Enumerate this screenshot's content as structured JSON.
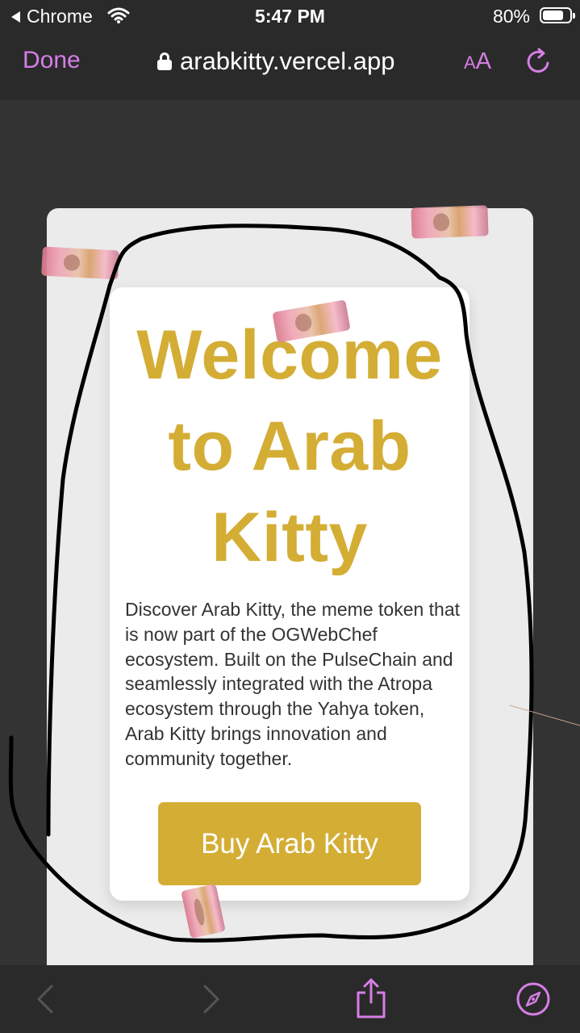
{
  "status_bar": {
    "back_app": "Chrome",
    "time": "5:47 PM",
    "battery": "80%",
    "battery_level": 0.8
  },
  "browser": {
    "done_label": "Done",
    "url": "arabkitty.vercel.app",
    "reader_label_small": "A",
    "reader_label_large": "A",
    "icons": [
      "lock-icon",
      "reload-icon",
      "back-arrow-icon",
      "forward-arrow-icon",
      "share-icon",
      "compass-icon"
    ]
  },
  "page": {
    "title": "Welcome to Arab Kitty",
    "description": "Discover Arab Kitty, the meme token that is now part of the OGWebChef ecosystem. Built on the PulseChain and seamlessly integrated with the Atropa ecosystem through the Yahya token, Arab Kitty brings innovation and community together.",
    "buy_button": "Buy Arab Kitty"
  },
  "colors": {
    "accent_gold": "#d4ad35",
    "browser_accent": "#d67ee6",
    "chrome_bg": "#2a2a2a",
    "page_bg": "#333333"
  }
}
